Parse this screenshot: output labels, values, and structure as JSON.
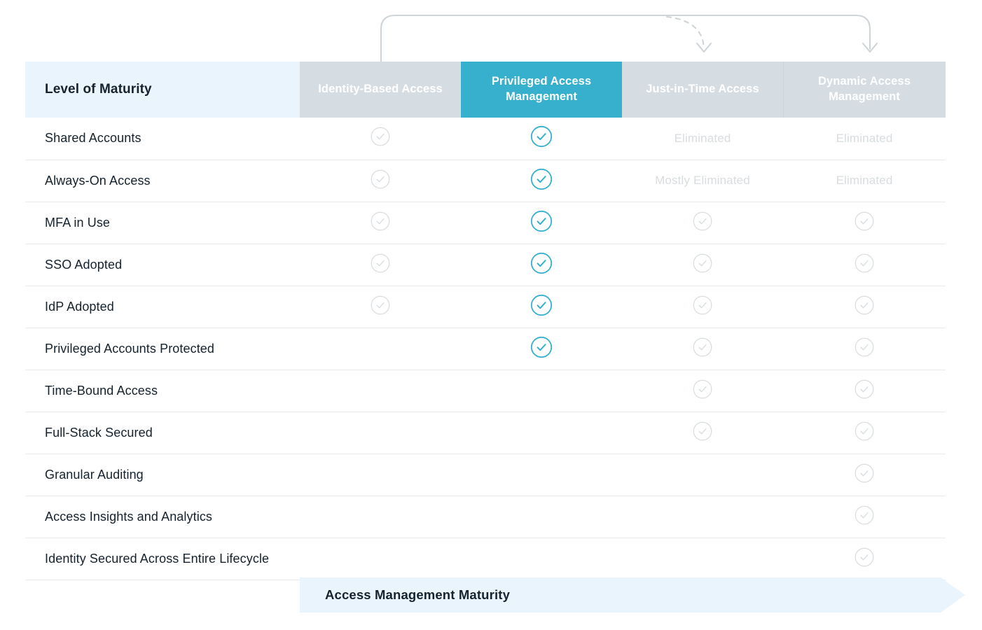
{
  "diagram": {
    "title_cell": "Level of Maturity",
    "columns": [
      {
        "label": "Identity-Based Access",
        "state": "dim"
      },
      {
        "label": "Privileged Access Management",
        "state": "active"
      },
      {
        "label": "Just-in-Time Access",
        "state": "dim"
      },
      {
        "label": "Dynamic Access Management",
        "state": "dim"
      }
    ],
    "rows": [
      {
        "label": "Shared Accounts",
        "cells": [
          {
            "kind": "check",
            "style": "faded"
          },
          {
            "kind": "check",
            "style": "active"
          },
          {
            "kind": "text",
            "text": "Eliminated"
          },
          {
            "kind": "text",
            "text": "Eliminated"
          }
        ]
      },
      {
        "label": "Always-On Access",
        "cells": [
          {
            "kind": "check",
            "style": "faded"
          },
          {
            "kind": "check",
            "style": "active"
          },
          {
            "kind": "text",
            "text": "Mostly Eliminated"
          },
          {
            "kind": "text",
            "text": "Eliminated"
          }
        ]
      },
      {
        "label": "MFA in Use",
        "cells": [
          {
            "kind": "check",
            "style": "faded"
          },
          {
            "kind": "check",
            "style": "active"
          },
          {
            "kind": "check",
            "style": "faded"
          },
          {
            "kind": "check",
            "style": "faded"
          }
        ]
      },
      {
        "label": "SSO Adopted",
        "cells": [
          {
            "kind": "check",
            "style": "faded"
          },
          {
            "kind": "check",
            "style": "active"
          },
          {
            "kind": "check",
            "style": "faded"
          },
          {
            "kind": "check",
            "style": "faded"
          }
        ]
      },
      {
        "label": "IdP Adopted",
        "cells": [
          {
            "kind": "check",
            "style": "faded"
          },
          {
            "kind": "check",
            "style": "active"
          },
          {
            "kind": "check",
            "style": "faded"
          },
          {
            "kind": "check",
            "style": "faded"
          }
        ]
      },
      {
        "label": "Privileged Accounts Protected",
        "cells": [
          {
            "kind": "empty"
          },
          {
            "kind": "check",
            "style": "active"
          },
          {
            "kind": "check",
            "style": "faded"
          },
          {
            "kind": "check",
            "style": "faded"
          }
        ]
      },
      {
        "label": "Time-Bound Access",
        "cells": [
          {
            "kind": "empty"
          },
          {
            "kind": "empty"
          },
          {
            "kind": "check",
            "style": "faded"
          },
          {
            "kind": "check",
            "style": "faded"
          }
        ]
      },
      {
        "label": "Full-Stack Secured",
        "cells": [
          {
            "kind": "empty"
          },
          {
            "kind": "empty"
          },
          {
            "kind": "check",
            "style": "faded"
          },
          {
            "kind": "check",
            "style": "faded"
          }
        ]
      },
      {
        "label": "Granular Auditing",
        "cells": [
          {
            "kind": "empty"
          },
          {
            "kind": "empty"
          },
          {
            "kind": "empty"
          },
          {
            "kind": "check",
            "style": "faded"
          }
        ]
      },
      {
        "label": "Access Insights and Analytics",
        "cells": [
          {
            "kind": "empty"
          },
          {
            "kind": "empty"
          },
          {
            "kind": "empty"
          },
          {
            "kind": "check",
            "style": "faded"
          }
        ]
      },
      {
        "label": "Identity Secured Across Entire Lifecycle",
        "cells": [
          {
            "kind": "empty"
          },
          {
            "kind": "empty"
          },
          {
            "kind": "empty"
          },
          {
            "kind": "check",
            "style": "faded"
          }
        ]
      }
    ],
    "banner": {
      "label": "Access Management Maturity",
      "color": "#e9f4fd"
    },
    "flow": {
      "solid_arrow_name": "progression-arrow",
      "dashed_arrow_name": "branch-arrow"
    },
    "colors": {
      "active": "#37b0cd",
      "dim_header": "#d6dde2",
      "label_header": "#e9f4fd",
      "faded_check": "#d8dde0",
      "text": "#15222d",
      "row_divider": "#e8ebed"
    }
  }
}
